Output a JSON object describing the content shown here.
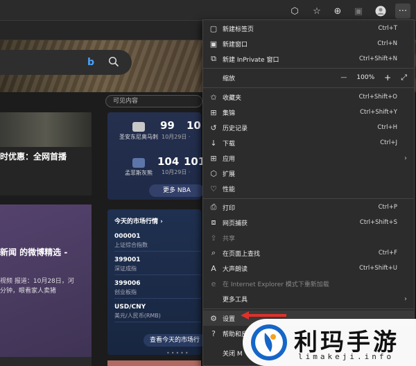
{
  "news": {
    "visible_label": "可见内容",
    "card1_title": "时优惠：全网首播",
    "card2_title": "新闻 的微博精选 -",
    "card2_desc_1": "视频 报道：10月28日，河",
    "card2_desc_2": "分钟，眼看家人卖猪"
  },
  "nba": {
    "game1": {
      "team": "圣安东尼奥马刺",
      "score": "99",
      "score2": "10",
      "date": "10月29日 ·",
      "logo_color": "#c8c8c8"
    },
    "game2": {
      "team": "孟菲斯灰熊",
      "score": "104",
      "score2": "101",
      "date": "10月29日 ·",
      "logo_color": "#5d76a9"
    },
    "more_label": "更多 NBA"
  },
  "market": {
    "title": "今天的市场行情",
    "rows": [
      {
        "code": "000001",
        "name": "上证综合指数"
      },
      {
        "code": "399001",
        "name": "深证成指"
      },
      {
        "code": "399006",
        "name": "创业板指"
      },
      {
        "code": "USD/CNY",
        "name": "美元/人民币(RMB)"
      }
    ],
    "button": "查看今天的市场行"
  },
  "menu": {
    "new_tab": {
      "label": "新建标签页",
      "shortcut": "Ctrl+T"
    },
    "new_window": {
      "label": "新建窗口",
      "shortcut": "Ctrl+N"
    },
    "new_private": {
      "label": "新建 InPrivate 窗口",
      "shortcut": "Ctrl+Shift+N"
    },
    "zoom": {
      "label": "缩放",
      "minus": "—",
      "value": "100%",
      "plus": "+",
      "full": "⤢"
    },
    "favorites": {
      "label": "收藏夹",
      "shortcut": "Ctrl+Shift+O"
    },
    "collections": {
      "label": "集锦",
      "shortcut": "Ctrl+Shift+Y"
    },
    "history": {
      "label": "历史记录",
      "shortcut": "Ctrl+H"
    },
    "downloads": {
      "label": "下载",
      "shortcut": "Ctrl+J"
    },
    "apps": {
      "label": "应用"
    },
    "extensions": {
      "label": "扩展"
    },
    "performance": {
      "label": "性能"
    },
    "print": {
      "label": "打印",
      "shortcut": "Ctrl+P"
    },
    "webcapture": {
      "label": "网页捕获",
      "shortcut": "Ctrl+Shift+S"
    },
    "share": {
      "label": "共享"
    },
    "find": {
      "label": "在页面上查找",
      "shortcut": "Ctrl+F"
    },
    "read_aloud": {
      "label": "大声朗读",
      "shortcut": "Ctrl+Shift+U"
    },
    "ie_mode": {
      "label": "在 Internet Explorer 模式下重新加载"
    },
    "more_tools": {
      "label": "更多工具"
    },
    "settings": {
      "label": "设置"
    },
    "help": {
      "label": "帮助和反"
    },
    "close": {
      "label": "关闭 M"
    }
  },
  "watermark": {
    "name": "利玛手游",
    "url": "limakeji.info"
  }
}
